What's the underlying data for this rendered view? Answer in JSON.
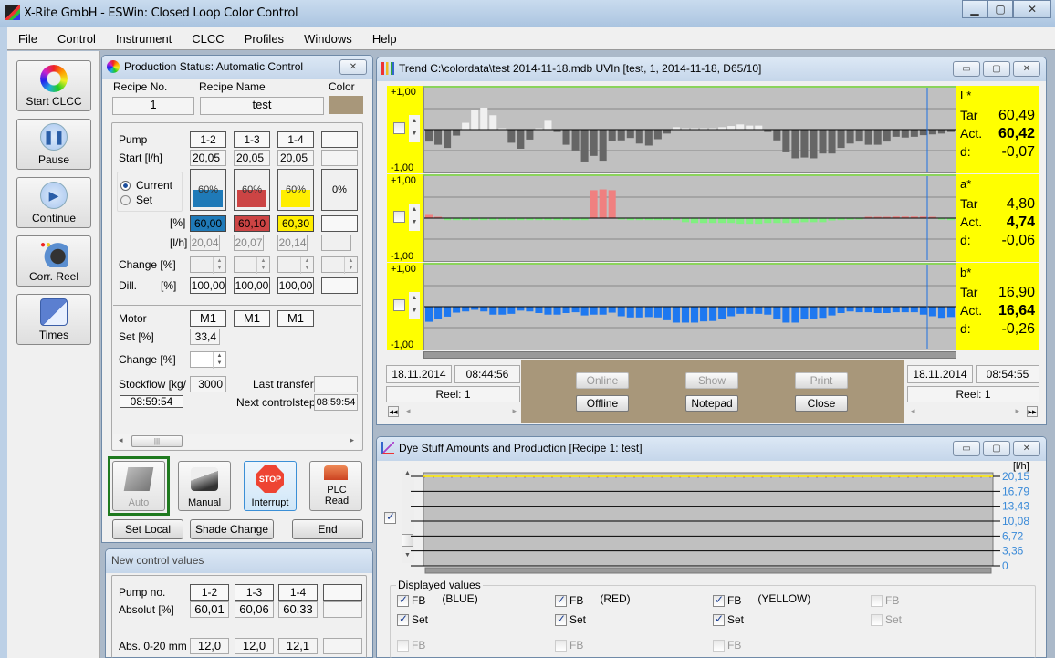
{
  "app": {
    "title": "X-Rite GmbH - ESWin: Closed Loop Color Control",
    "window_controls": [
      "minimize",
      "maximize",
      "close"
    ]
  },
  "menu": [
    "File",
    "Control",
    "Instrument",
    "CLCC",
    "Profiles",
    "Windows",
    "Help"
  ],
  "toolbar": [
    {
      "label": "Start CLCC",
      "icon": "color-wheel-icon"
    },
    {
      "label": "Pause",
      "icon": "pause-icon"
    },
    {
      "label": "Continue",
      "icon": "play-icon"
    },
    {
      "label": "Corr. Reel",
      "icon": "gear-reel-icon"
    },
    {
      "label": "Times",
      "icon": "calculator-clock-icon"
    }
  ],
  "production": {
    "title": "Production Status: Automatic Control",
    "recipe_no_label": "Recipe No.",
    "recipe_name_label": "Recipe Name",
    "color_label": "Color",
    "recipe_no": "1",
    "recipe_name": "test",
    "recipe_color": "#a8977a",
    "pump_label": "Pump",
    "start_label": "Start [l/h]",
    "pumps": [
      {
        "id": "1-2",
        "start": "20,05",
        "fill_pct": 60,
        "fill_label": "60%",
        "color": "#1f7ab8",
        "pct": "60,00",
        "lh": "20,04",
        "dill": "100,00",
        "motor": "M1"
      },
      {
        "id": "1-3",
        "start": "20,05",
        "fill_pct": 60,
        "fill_label": "60%",
        "color": "#cc4444",
        "pct": "60,10",
        "lh": "20,07",
        "dill": "100,00",
        "motor": "M1"
      },
      {
        "id": "1-4",
        "start": "20,05",
        "fill_pct": 60,
        "fill_label": "60%",
        "color": "#ffee00",
        "pct": "60,30",
        "lh": "20,14",
        "dill": "100,00",
        "motor": "M1"
      },
      {
        "id": "",
        "start": "",
        "fill_pct": 0,
        "fill_label": "0%",
        "color": "#f0f0f0",
        "pct": "",
        "lh": "",
        "dill": "",
        "motor": ""
      }
    ],
    "radio_current": "Current",
    "radio_set": "Set",
    "radio_selected": "Current",
    "pct_label": "[%]",
    "lh_label": "[l/h]",
    "change_label": "Change [%]",
    "dill_label": "Dill.",
    "dill_unit": "[%]",
    "motor_label": "Motor",
    "set_label": "Set [%]",
    "set_value": "33,4",
    "motor_change_label": "Change [%]",
    "stockflow_label": "Stockflow [kg/",
    "stockflow_value": "3000",
    "last_transfer_label": "Last transfer",
    "last_transfer_value": "",
    "time_value": "08:59:54",
    "next_step_label": "Next controlstep",
    "next_step_value": "08:59:54",
    "buttons": {
      "auto": "Auto",
      "manual": "Manual",
      "interrupt": "Interrupt",
      "stop_sign": "STOP",
      "plc_read": "PLC Read",
      "set_local": "Set Local",
      "shade_change": "Shade Change",
      "end": "End"
    }
  },
  "new_control": {
    "title": "New control values",
    "pump_label": "Pump no.",
    "absolut_label": "Absolut [%]",
    "abs_mm_label": "Abs. 0-20 mm",
    "pumps": [
      "1-2",
      "1-3",
      "1-4",
      ""
    ],
    "absolut": [
      "60,01",
      "60,06",
      "60,33",
      ""
    ],
    "abs_mm": [
      "12,0",
      "12,0",
      "12,1",
      ""
    ]
  },
  "trend": {
    "title": "Trend C:\\colordata\\test 2014-11-18.mdb UVIn [test, 1, 2014-11-18, D65/10]",
    "start_date": "18.11.2014",
    "start_time": "08:44:56",
    "end_date": "18.11.2014",
    "end_time": "08:54:55",
    "reel_left": "Reel: 1",
    "reel_right": "Reel: 1",
    "buttons": {
      "online": "Online",
      "show": "Show",
      "print": "Print",
      "offline": "Offline",
      "notepad": "Notepad",
      "close": "Close"
    }
  },
  "dye": {
    "title": "Dye Stuff Amounts and Production [Recipe 1: test]",
    "unit": "[l/h]",
    "displayed_values_label": "Displayed values",
    "checkboxes": [
      {
        "label": "FB",
        "note": "(BLUE)",
        "checked": true,
        "enabled": true
      },
      {
        "label": "FB",
        "note": "(RED)",
        "checked": true,
        "enabled": true
      },
      {
        "label": "FB",
        "note": "(YELLOW)",
        "checked": true,
        "enabled": true
      },
      {
        "label": "FB",
        "note": "",
        "checked": false,
        "enabled": false
      },
      {
        "label": "Set",
        "note": "",
        "checked": true,
        "enabled": true
      },
      {
        "label": "Set",
        "note": "",
        "checked": true,
        "enabled": true
      },
      {
        "label": "Set",
        "note": "",
        "checked": true,
        "enabled": true
      },
      {
        "label": "Set",
        "note": "",
        "checked": false,
        "enabled": false
      },
      {
        "label": "FB",
        "note": "",
        "checked": false,
        "enabled": false
      },
      {
        "label": "FB",
        "note": "",
        "checked": false,
        "enabled": false
      },
      {
        "label": "FB",
        "note": "",
        "checked": false,
        "enabled": false
      }
    ]
  },
  "chart_data": [
    {
      "type": "bar",
      "title": "L*",
      "ylim": [
        -1,
        1
      ],
      "ytick_labels": [
        "+1,00",
        "-1,00"
      ],
      "target_label": "Tar",
      "target": "60,49",
      "actual_label": "Act.",
      "actual": "60,42",
      "delta_label": "d:",
      "delta": "-0,07",
      "positive_color": "#f0f0f0",
      "negative_color": "#666666",
      "values": [
        -0.3,
        -0.38,
        -0.46,
        -0.15,
        0.17,
        0.5,
        0.55,
        0.36,
        0.02,
        -0.33,
        -0.48,
        -0.25,
        0,
        0.22,
        -0.06,
        -0.38,
        -0.52,
        -0.8,
        -0.66,
        -0.78,
        -0.28,
        -0.27,
        -0.21,
        -0.35,
        -0.4,
        -0.24,
        -0.1,
        0.06,
        0.03,
        0.03,
        0.03,
        0.03,
        0.06,
        0.09,
        0.13,
        0.1,
        0.1,
        -0.06,
        -0.27,
        -0.57,
        -0.72,
        -0.7,
        -0.72,
        -0.6,
        -0.6,
        -0.46,
        -0.35,
        -0.3,
        -0.38,
        -0.38,
        -0.3,
        -0.18,
        -0.2,
        -0.18,
        -0.14,
        -0.12,
        -0.1,
        -0.06
      ]
    },
    {
      "type": "bar",
      "title": "a*",
      "ylim": [
        -1,
        1
      ],
      "ytick_labels": [
        "+1,00",
        "-1,00"
      ],
      "target_label": "Tar",
      "target": "4,80",
      "actual_label": "Act.",
      "actual": "4,74",
      "delta_label": "d:",
      "delta": "-0,06",
      "positive_color": "#f08080",
      "negative_color": "#80f080",
      "values": [
        0.08,
        0.02,
        -0.05,
        -0.05,
        -0.05,
        -0.05,
        -0.05,
        -0.05,
        -0.05,
        -0.05,
        -0.05,
        -0.05,
        -0.05,
        -0.05,
        -0.05,
        -0.05,
        -0.05,
        -0.05,
        0.7,
        0.72,
        0.7,
        -0.02,
        -0.05,
        -0.05,
        -0.05,
        -0.05,
        -0.05,
        -0.05,
        -0.1,
        -0.12,
        -0.12,
        -0.12,
        -0.12,
        -0.12,
        -0.14,
        -0.14,
        -0.14,
        -0.12,
        -0.12,
        -0.12,
        -0.12,
        -0.1,
        -0.1,
        -0.1,
        -0.06,
        -0.05,
        -0.04,
        -0.02,
        0.02,
        0.01,
        0.02,
        0.04,
        0.04,
        0.04,
        0.04,
        0,
        -0.03,
        -0.05
      ]
    },
    {
      "type": "bar",
      "title": "b*",
      "ylim": [
        -1,
        1
      ],
      "ytick_labels": [
        "+1,00",
        "-1,00"
      ],
      "target_label": "Tar",
      "target": "16,90",
      "actual_label": "Act.",
      "actual": "16,64",
      "delta_label": "d:",
      "delta": "-0,26",
      "positive_color": "#1e78f0",
      "negative_color": "#1e78f0",
      "values": [
        -0.38,
        -0.3,
        -0.25,
        -0.15,
        -0.12,
        -0.08,
        -0.12,
        -0.2,
        -0.2,
        -0.18,
        -0.1,
        -0.12,
        -0.16,
        -0.2,
        -0.2,
        -0.16,
        -0.14,
        -0.22,
        -0.2,
        -0.2,
        -0.15,
        -0.24,
        -0.27,
        -0.27,
        -0.26,
        -0.27,
        -0.34,
        -0.4,
        -0.4,
        -0.4,
        -0.37,
        -0.36,
        -0.32,
        -0.24,
        -0.18,
        -0.18,
        -0.18,
        -0.2,
        -0.3,
        -0.4,
        -0.4,
        -0.32,
        -0.3,
        -0.28,
        -0.22,
        -0.16,
        -0.12,
        -0.14,
        -0.14,
        -0.16,
        -0.16,
        -0.14,
        -0.14,
        -0.14,
        -0.2,
        -0.24,
        -0.28,
        -0.26
      ]
    },
    {
      "type": "line",
      "title": "Dye Stuff Amounts and Production",
      "ylabel": "[l/h]",
      "ylim": [
        0,
        20.15
      ],
      "ytick_labels": [
        "20,15",
        "16,79",
        "13,43",
        "10,08",
        "6,72",
        "3,36",
        "0"
      ],
      "series": [
        {
          "name": "FB (BLUE)",
          "color": "#1e78f0",
          "values": [
            20.04,
            20.04
          ]
        },
        {
          "name": "FB (RED)",
          "color": "#cc4444",
          "values": [
            20.07,
            20.07
          ]
        },
        {
          "name": "FB (YELLOW)",
          "color": "#ffee00",
          "values": [
            20.14,
            20.14
          ]
        }
      ]
    }
  ]
}
